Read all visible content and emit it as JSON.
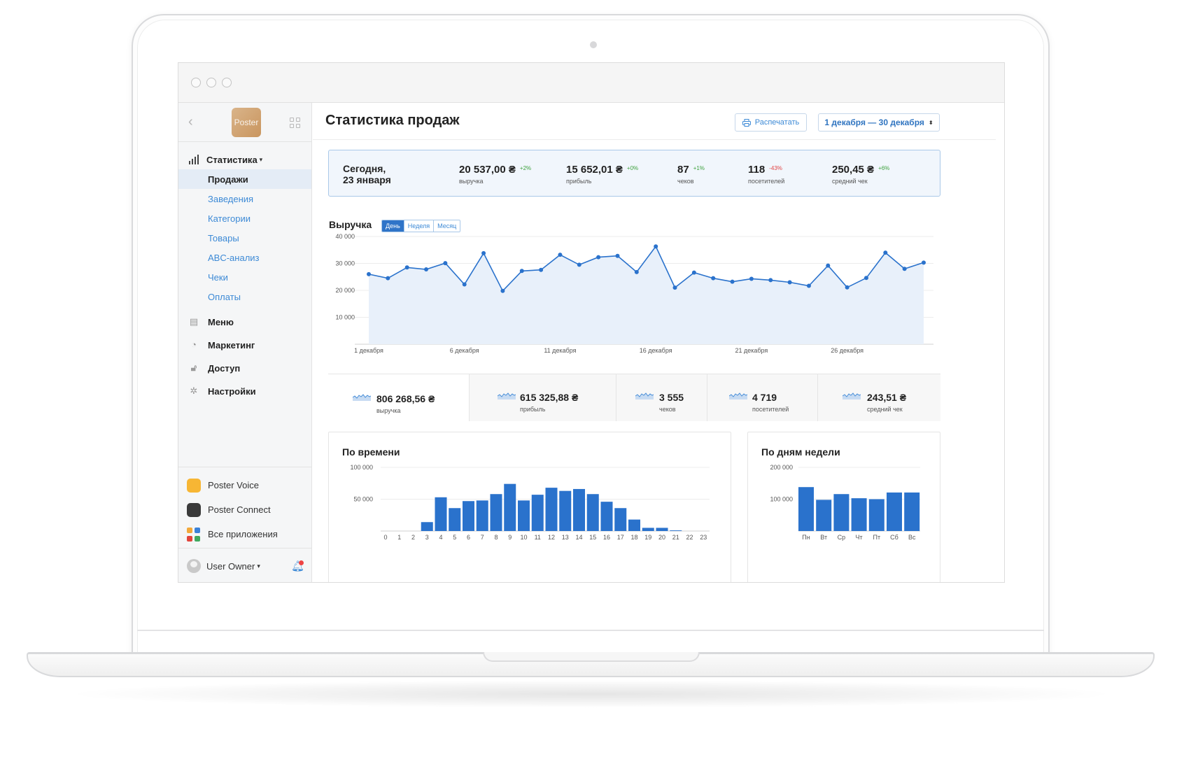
{
  "header": {
    "title": "Статистика продаж",
    "print_label": "Распечатать",
    "date_range": "1 декабря — 30 декабря"
  },
  "sidebar": {
    "logo": "Poster",
    "stats": {
      "label": "Статистика"
    },
    "sub_items": [
      {
        "label": "Продажи",
        "active": true
      },
      {
        "label": "Заведения"
      },
      {
        "label": "Категории"
      },
      {
        "label": "Товары"
      },
      {
        "label": "ABC-анализ"
      },
      {
        "label": "Чеки"
      },
      {
        "label": "Оплаты"
      }
    ],
    "main_items": [
      {
        "label": "Меню",
        "icon": "document-icon"
      },
      {
        "label": "Маркетинг",
        "icon": "pie-icon"
      },
      {
        "label": "Доступ",
        "icon": "lock-icon"
      },
      {
        "label": "Настройки",
        "icon": "gear-icon"
      }
    ],
    "apps": [
      {
        "label": "Poster Voice"
      },
      {
        "label": "Poster Connect"
      },
      {
        "label": "Все приложения"
      }
    ],
    "user": "User Owner"
  },
  "today": {
    "label_line1": "Сегодня,",
    "label_line2": "23 января",
    "kpis": [
      {
        "value": "20 537,00 ₴",
        "delta": "+2%",
        "label": "выручка"
      },
      {
        "value": "15 652,01 ₴",
        "delta": "+0%",
        "label": "прибыль"
      },
      {
        "value": "87",
        "delta": "+1%",
        "label": "чеков"
      },
      {
        "value": "118",
        "delta": "-43%",
        "label": "посетителей"
      },
      {
        "value": "250,45 ₴",
        "delta": "+6%",
        "label": "средний чек"
      }
    ]
  },
  "revenue_chart": {
    "title": "Выручка",
    "periods": [
      "День",
      "Неделя",
      "Месяц"
    ],
    "active_period": "День"
  },
  "totals": [
    {
      "value": "806 268,56 ₴",
      "label": "выручка"
    },
    {
      "value": "615 325,88 ₴",
      "label": "прибыль"
    },
    {
      "value": "3 555",
      "label": "чеков"
    },
    {
      "value": "4 719",
      "label": "посетителей"
    },
    {
      "value": "243,51 ₴",
      "label": "средний чек"
    }
  ],
  "by_time": {
    "title": "По времени"
  },
  "by_weekday": {
    "title": "По дням недели"
  },
  "chart_data": [
    {
      "type": "area",
      "title": "Выручка",
      "x_ticks": [
        "1 декабря",
        "6 декабря",
        "11 декабря",
        "16 декабря",
        "21 декабря",
        "26 декабря"
      ],
      "x": [
        1,
        2,
        3,
        4,
        5,
        6,
        7,
        8,
        9,
        10,
        11,
        12,
        13,
        14,
        15,
        16,
        17,
        18,
        19,
        20,
        21,
        22,
        23,
        24,
        25,
        26,
        27,
        28,
        29,
        30
      ],
      "values": [
        26000,
        24500,
        28500,
        27800,
        30100,
        22200,
        33800,
        19800,
        27200,
        27600,
        33200,
        29500,
        32300,
        32800,
        26800,
        36300,
        21000,
        26600,
        24500,
        23200,
        24300,
        23800,
        23000,
        21700,
        29200,
        21100,
        24600,
        34000,
        28000,
        30300
      ],
      "y_ticks": [
        "40 000",
        "30 000",
        "20 000",
        "10 000"
      ],
      "ylim": [
        0,
        40000
      ],
      "grid": true
    },
    {
      "type": "bar",
      "title": "По времени",
      "categories": [
        "0",
        "1",
        "2",
        "3",
        "4",
        "5",
        "6",
        "7",
        "8",
        "9",
        "10",
        "11",
        "12",
        "13",
        "14",
        "15",
        "16",
        "17",
        "18",
        "19",
        "20",
        "21",
        "22",
        "23"
      ],
      "values": [
        0,
        0,
        0,
        14000,
        53000,
        36000,
        47000,
        48000,
        58000,
        74000,
        48000,
        57000,
        68000,
        63000,
        66000,
        58000,
        46000,
        36000,
        18000,
        5000,
        5000,
        1000,
        0,
        0
      ],
      "y_ticks": [
        "100 000",
        "50 000"
      ],
      "ylim": [
        0,
        100000
      ],
      "grid": true
    },
    {
      "type": "bar",
      "title": "По дням недели",
      "categories": [
        "Пн",
        "Вт",
        "Ср",
        "Чт",
        "Пт",
        "Сб",
        "Вс"
      ],
      "values": [
        138000,
        98000,
        116000,
        103000,
        100000,
        121000,
        121000
      ],
      "y_ticks": [
        "200 000",
        "100 000"
      ],
      "ylim": [
        0,
        200000
      ],
      "grid": true
    }
  ]
}
